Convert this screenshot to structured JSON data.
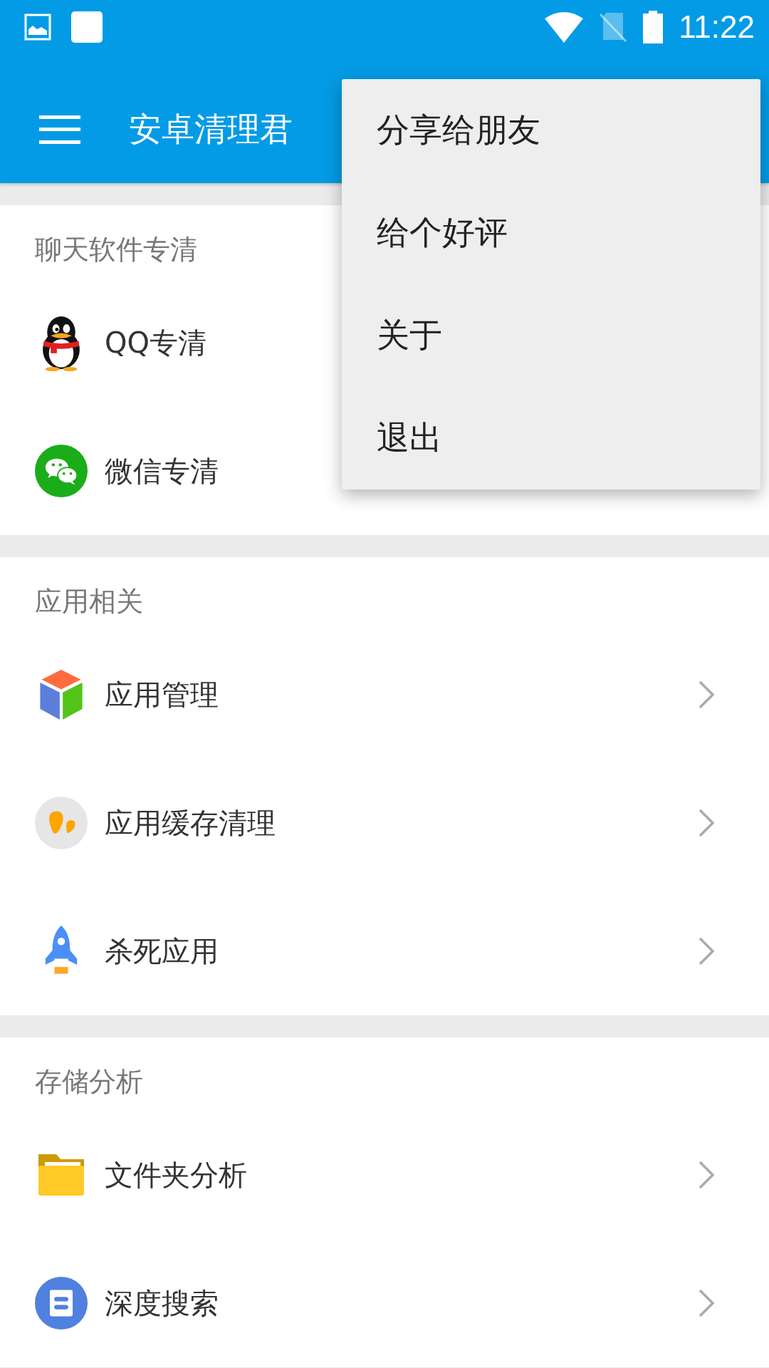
{
  "status_bar": {
    "time": "11:22"
  },
  "app_bar": {
    "title": "安卓清理君"
  },
  "sections": [
    {
      "title": "聊天软件专清",
      "items": [
        {
          "label": "QQ专清",
          "arrow": false
        },
        {
          "label": "微信专清",
          "arrow": false
        }
      ]
    },
    {
      "title": "应用相关",
      "items": [
        {
          "label": "应用管理",
          "arrow": true
        },
        {
          "label": "应用缓存清理",
          "arrow": true
        },
        {
          "label": "杀死应用",
          "arrow": true
        }
      ]
    },
    {
      "title": "存储分析",
      "items": [
        {
          "label": "文件夹分析",
          "arrow": true
        },
        {
          "label": "深度搜索",
          "arrow": true
        }
      ]
    }
  ],
  "menu": {
    "items": [
      "分享给朋友",
      "给个好评",
      "关于",
      "退出"
    ]
  }
}
